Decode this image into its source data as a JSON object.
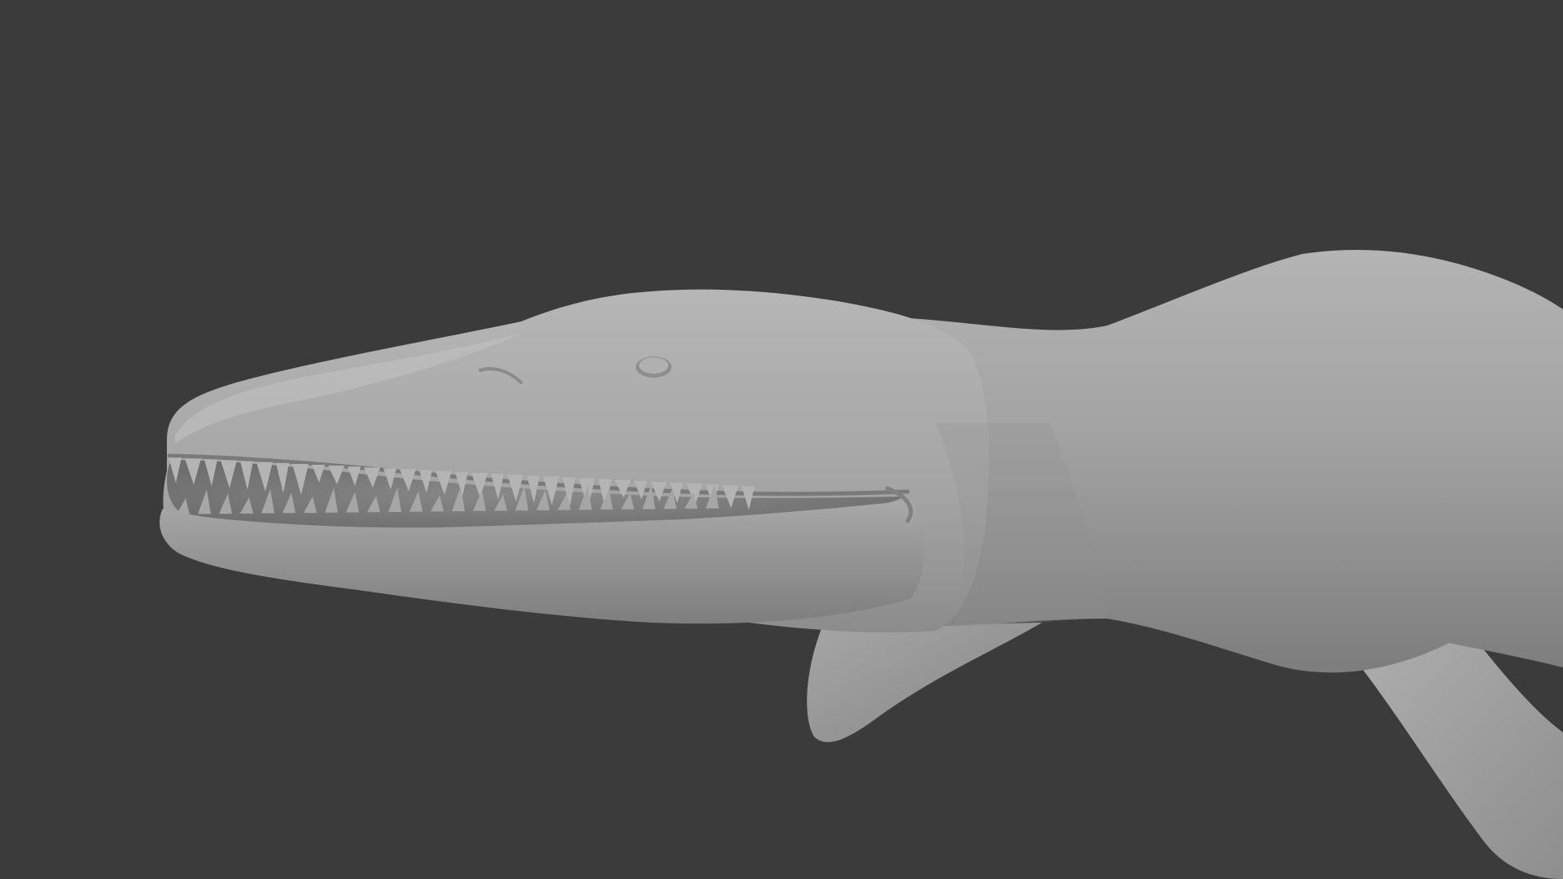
{
  "viewport": {
    "background_color": "#3b3b3b",
    "model_base_color": "#9c9c9c",
    "model_highlight_color": "#bdbdbd",
    "model_shadow_color": "#6a6a6a",
    "tooth_color": "#b4b4b4"
  },
  "model": {
    "subject": "marine-reptile-sculpt",
    "parts": [
      "head",
      "eye",
      "upper-jaw",
      "lower-jaw",
      "teeth",
      "neck",
      "body",
      "front-flipper",
      "rear-flipper"
    ]
  }
}
